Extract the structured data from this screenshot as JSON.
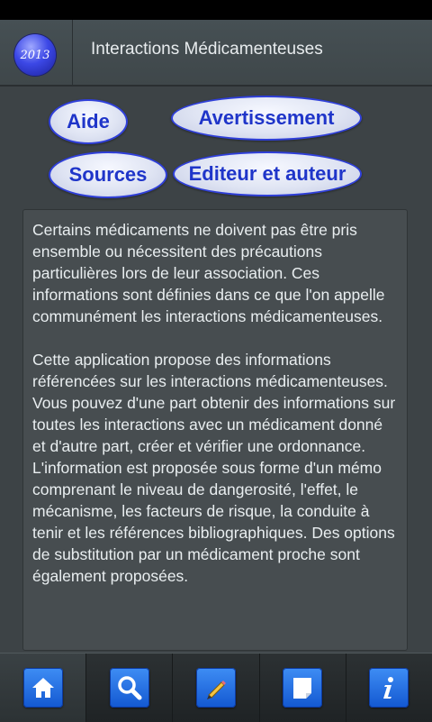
{
  "header": {
    "logo_text": "2013",
    "title": "Interactions Médicamenteuses"
  },
  "buttons": {
    "aide": "Aide",
    "avertissement": "Avertissement",
    "sources": "Sources",
    "editeur": "Editeur et auteur"
  },
  "content": {
    "paragraph1": "Certains médicaments ne doivent pas être pris ensemble ou nécessitent des précautions particulières lors de leur association. Ces informations sont définies dans ce que l'on appelle communément les interactions médicamenteuses.",
    "paragraph2": "Cette application propose des informations référencées sur les interactions médicamenteuses. Vous pouvez d'une part obtenir des informations sur toutes les interactions avec un médicament donné et d'autre part,  créer et vérifier une ordonnance. L'information est proposée sous forme d'un mémo comprenant le niveau de dangerosité, l'effet, le mécanisme, les facteurs de risque, la conduite à tenir et les références bibliographiques. Des options de substitution par un médicament proche sont également proposées."
  },
  "tabbar": {
    "items": [
      {
        "icon": "home-icon",
        "selected": true
      },
      {
        "icon": "search-icon",
        "selected": false
      },
      {
        "icon": "pencil-icon",
        "selected": false
      },
      {
        "icon": "note-icon",
        "selected": false
      },
      {
        "icon": "info-icon",
        "selected": false
      }
    ]
  },
  "colors": {
    "background": "#3d4346",
    "button_text": "#1f35c9",
    "icon_blue": "#1e6be6"
  }
}
